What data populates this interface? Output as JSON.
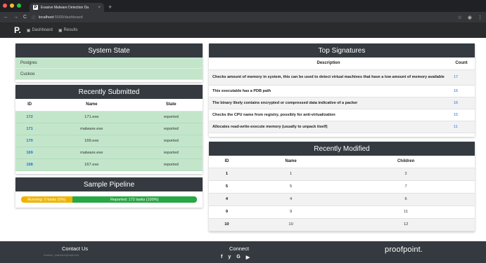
{
  "browser": {
    "tab_title": "Evasive Malware Detection Da",
    "tab_close": "×",
    "new_tab": "+",
    "url_host": "localhost",
    "url_path": ":5000/dashboard",
    "back": "←",
    "forward": "→",
    "reload": "C",
    "info": "ⓘ",
    "star": "☆",
    "menu": "⋮",
    "account": "◉",
    "dot_colors": [
      "#ff5f57",
      "#febc2e",
      "#28c840"
    ]
  },
  "nav": {
    "brand": "P.",
    "links": [
      {
        "icon": "▣",
        "label": "Dashboard"
      },
      {
        "icon": "▣",
        "label": "Results"
      }
    ]
  },
  "system_state": {
    "title": "System State",
    "rows": [
      "Postgres",
      "Cuckoo"
    ]
  },
  "recent_submitted": {
    "title": "Recently Submitted",
    "headers": [
      "ID",
      "Name",
      "State"
    ],
    "rows": [
      {
        "id": "172",
        "name": "171.exe",
        "state": "reported"
      },
      {
        "id": "171",
        "name": "malware.exe",
        "state": "reported"
      },
      {
        "id": "170",
        "name": "169.exe",
        "state": "reported"
      },
      {
        "id": "169",
        "name": "malware.exe",
        "state": "reported"
      },
      {
        "id": "168",
        "name": "167.exe",
        "state": "reported"
      }
    ]
  },
  "pipeline": {
    "title": "Sample Pipeline",
    "running_label": "Running: 0 tasks (0%)",
    "reported_label": "Reported: 172 tasks (100%)",
    "running_fraction": 0.29
  },
  "top_signatures": {
    "title": "Top Signatures",
    "headers": [
      "Description",
      "Count"
    ],
    "rows": [
      {
        "desc": "Checks amount of memory in system, this can be used to detect virtual machines that have a low amount of memory available",
        "count": "17"
      },
      {
        "desc": "This executable has a PDB path",
        "count": "16"
      },
      {
        "desc": "The binary likely contains encrypted or compressed data indicative of a packer",
        "count": "16"
      },
      {
        "desc": "Checks the CPU name from registry, possibly for anti-virtualization",
        "count": "15"
      },
      {
        "desc": "Allocates read-write-execute memory (usually to unpack itself)",
        "count": "11"
      }
    ]
  },
  "recent_modified": {
    "title": "Recently Modified",
    "headers": [
      "ID",
      "Name",
      "Children"
    ],
    "rows": [
      {
        "id": "1",
        "name": "1",
        "children": "2"
      },
      {
        "id": "5",
        "name": "5",
        "children": "7"
      },
      {
        "id": "4",
        "name": "4",
        "children": "6"
      },
      {
        "id": "9",
        "name": "9",
        "children": "11"
      },
      {
        "id": "10",
        "name": "10",
        "children": "12"
      }
    ]
  },
  "footer": {
    "contact_title": "Contact Us",
    "contact_email": "evasive_malware@mail.edu",
    "connect_title": "Connect",
    "social": [
      "f",
      "y",
      "G",
      "▶"
    ],
    "brand": "proofpoint."
  },
  "colors": {
    "green_row": "#c3e6cb",
    "header_dark": "#343a40",
    "running": "#f0b400",
    "reported": "#28a745",
    "link": "#1a73e8"
  }
}
